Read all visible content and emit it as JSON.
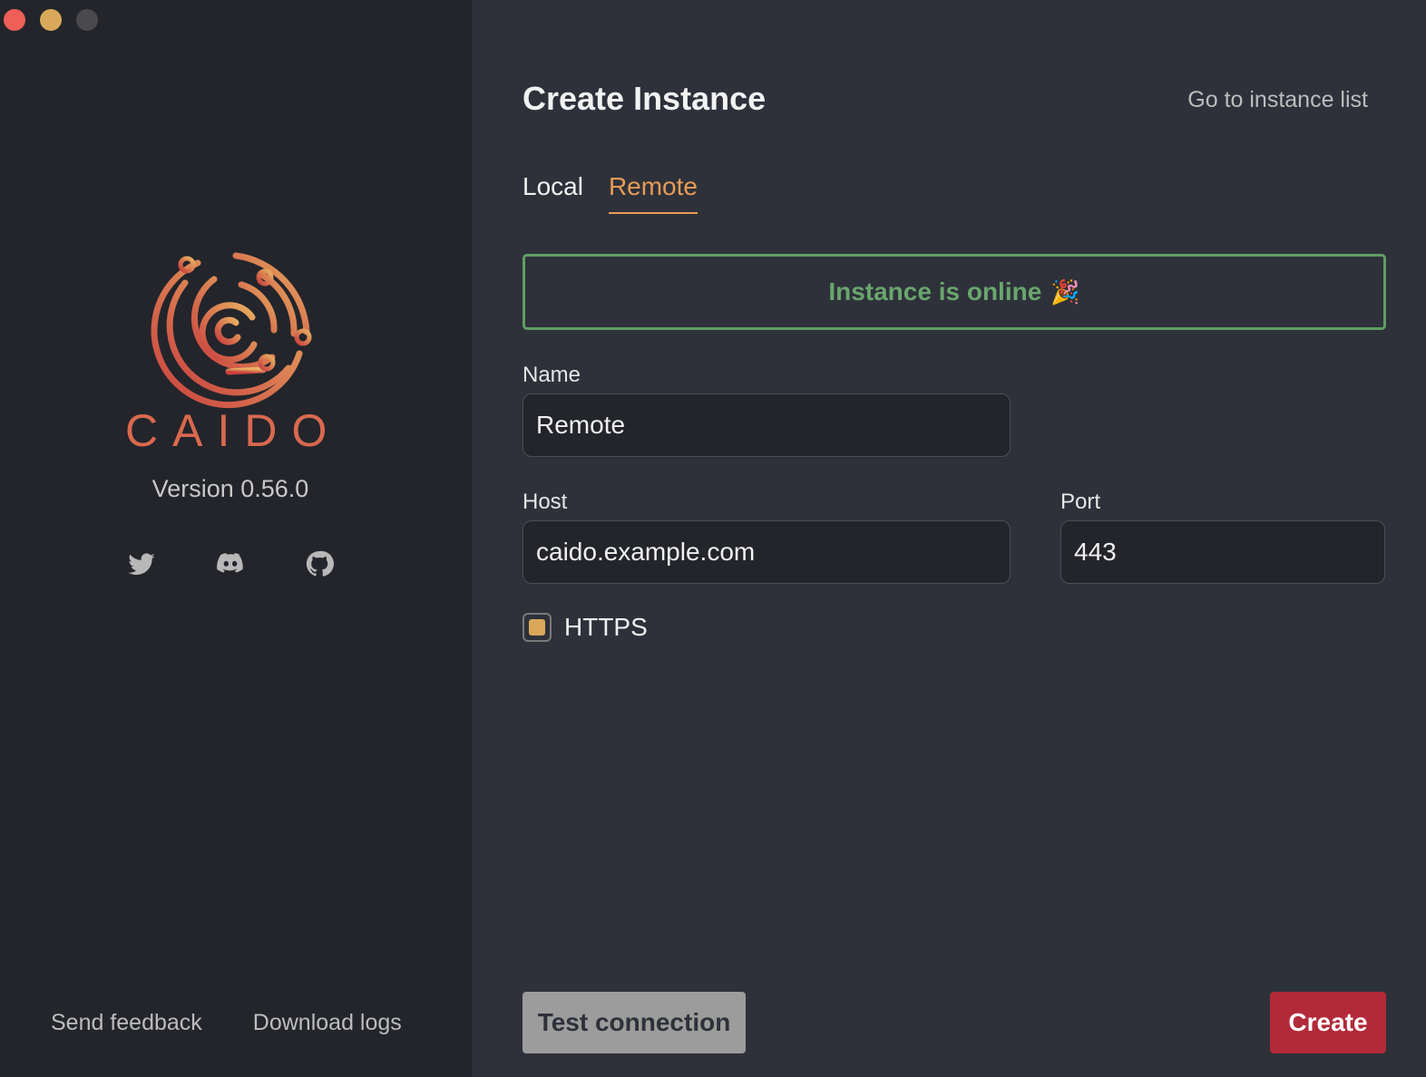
{
  "sidebar": {
    "logo_text": "CAIDO",
    "version": "Version 0.56.0",
    "socials": [
      {
        "icon": "twitter-icon"
      },
      {
        "icon": "discord-icon"
      },
      {
        "icon": "github-icon"
      }
    ],
    "footer": {
      "feedback": "Send feedback",
      "logs": "Download logs"
    }
  },
  "main": {
    "title": "Create Instance",
    "goto_list": "Go to instance list",
    "tabs": [
      {
        "label": "Local",
        "active": false
      },
      {
        "label": "Remote",
        "active": true
      }
    ],
    "status_banner": {
      "text": "Instance is online",
      "emoji": "🎉",
      "color": "#6aa56d"
    },
    "form": {
      "name_label": "Name",
      "name_value": "Remote",
      "host_label": "Host",
      "host_value": "caido.example.com",
      "port_label": "Port",
      "port_value": "443",
      "https_label": "HTTPS",
      "https_checked": true
    },
    "buttons": {
      "test": "Test connection",
      "create": "Create"
    }
  },
  "colors": {
    "accent": "#e89b56",
    "create_button": "#b22a3a",
    "success": "#5f9e62"
  }
}
